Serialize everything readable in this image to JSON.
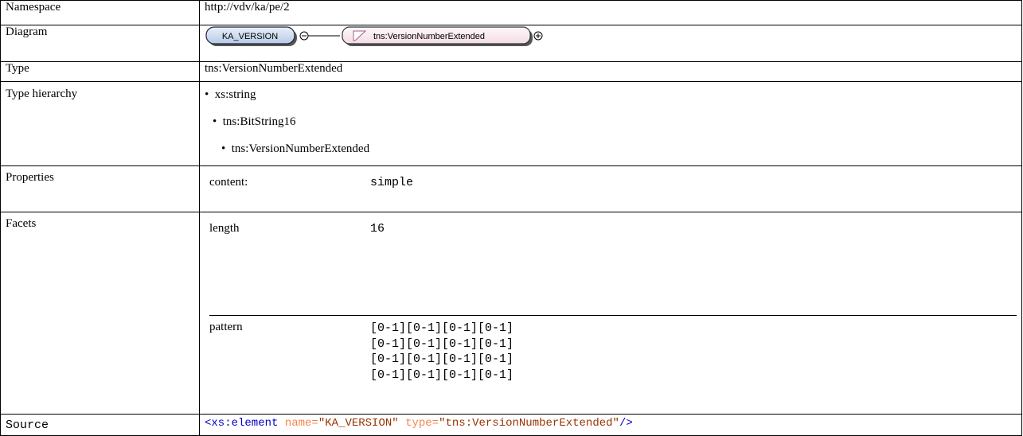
{
  "namespace": {
    "label": "Namespace",
    "value": "http://vdv/ka/pe/2"
  },
  "diagram": {
    "label": "Diagram",
    "element_name": "KA_VERSION",
    "type_name": "tns:VersionNumberExtended",
    "collapse_symbol": "⊖",
    "expand_symbol": "⊕"
  },
  "type": {
    "label": "Type",
    "value": "tns:VersionNumberExtended"
  },
  "hierarchy": {
    "label": "Type hierarchy",
    "items": [
      "xs:string",
      "tns:BitString16",
      "tns:VersionNumberExtended"
    ]
  },
  "properties": {
    "label": "Properties",
    "key": "content:",
    "value": "simple"
  },
  "facets": {
    "label": "Facets",
    "rows": [
      {
        "name": "length",
        "value": "16"
      },
      {
        "name": "pattern",
        "value_lines": [
          "[0-1][0-1][0-1][0-1]",
          "[0-1][0-1][0-1][0-1]",
          "[0-1][0-1][0-1][0-1]",
          "[0-1][0-1][0-1][0-1]"
        ]
      }
    ]
  },
  "source": {
    "label": "Source",
    "open": "<xs:element",
    "attr1": "name=",
    "val1": "\"KA_VERSION\"",
    "attr2": "type=",
    "val2": "\"tns:VersionNumberExtended\"",
    "close": "/>"
  }
}
